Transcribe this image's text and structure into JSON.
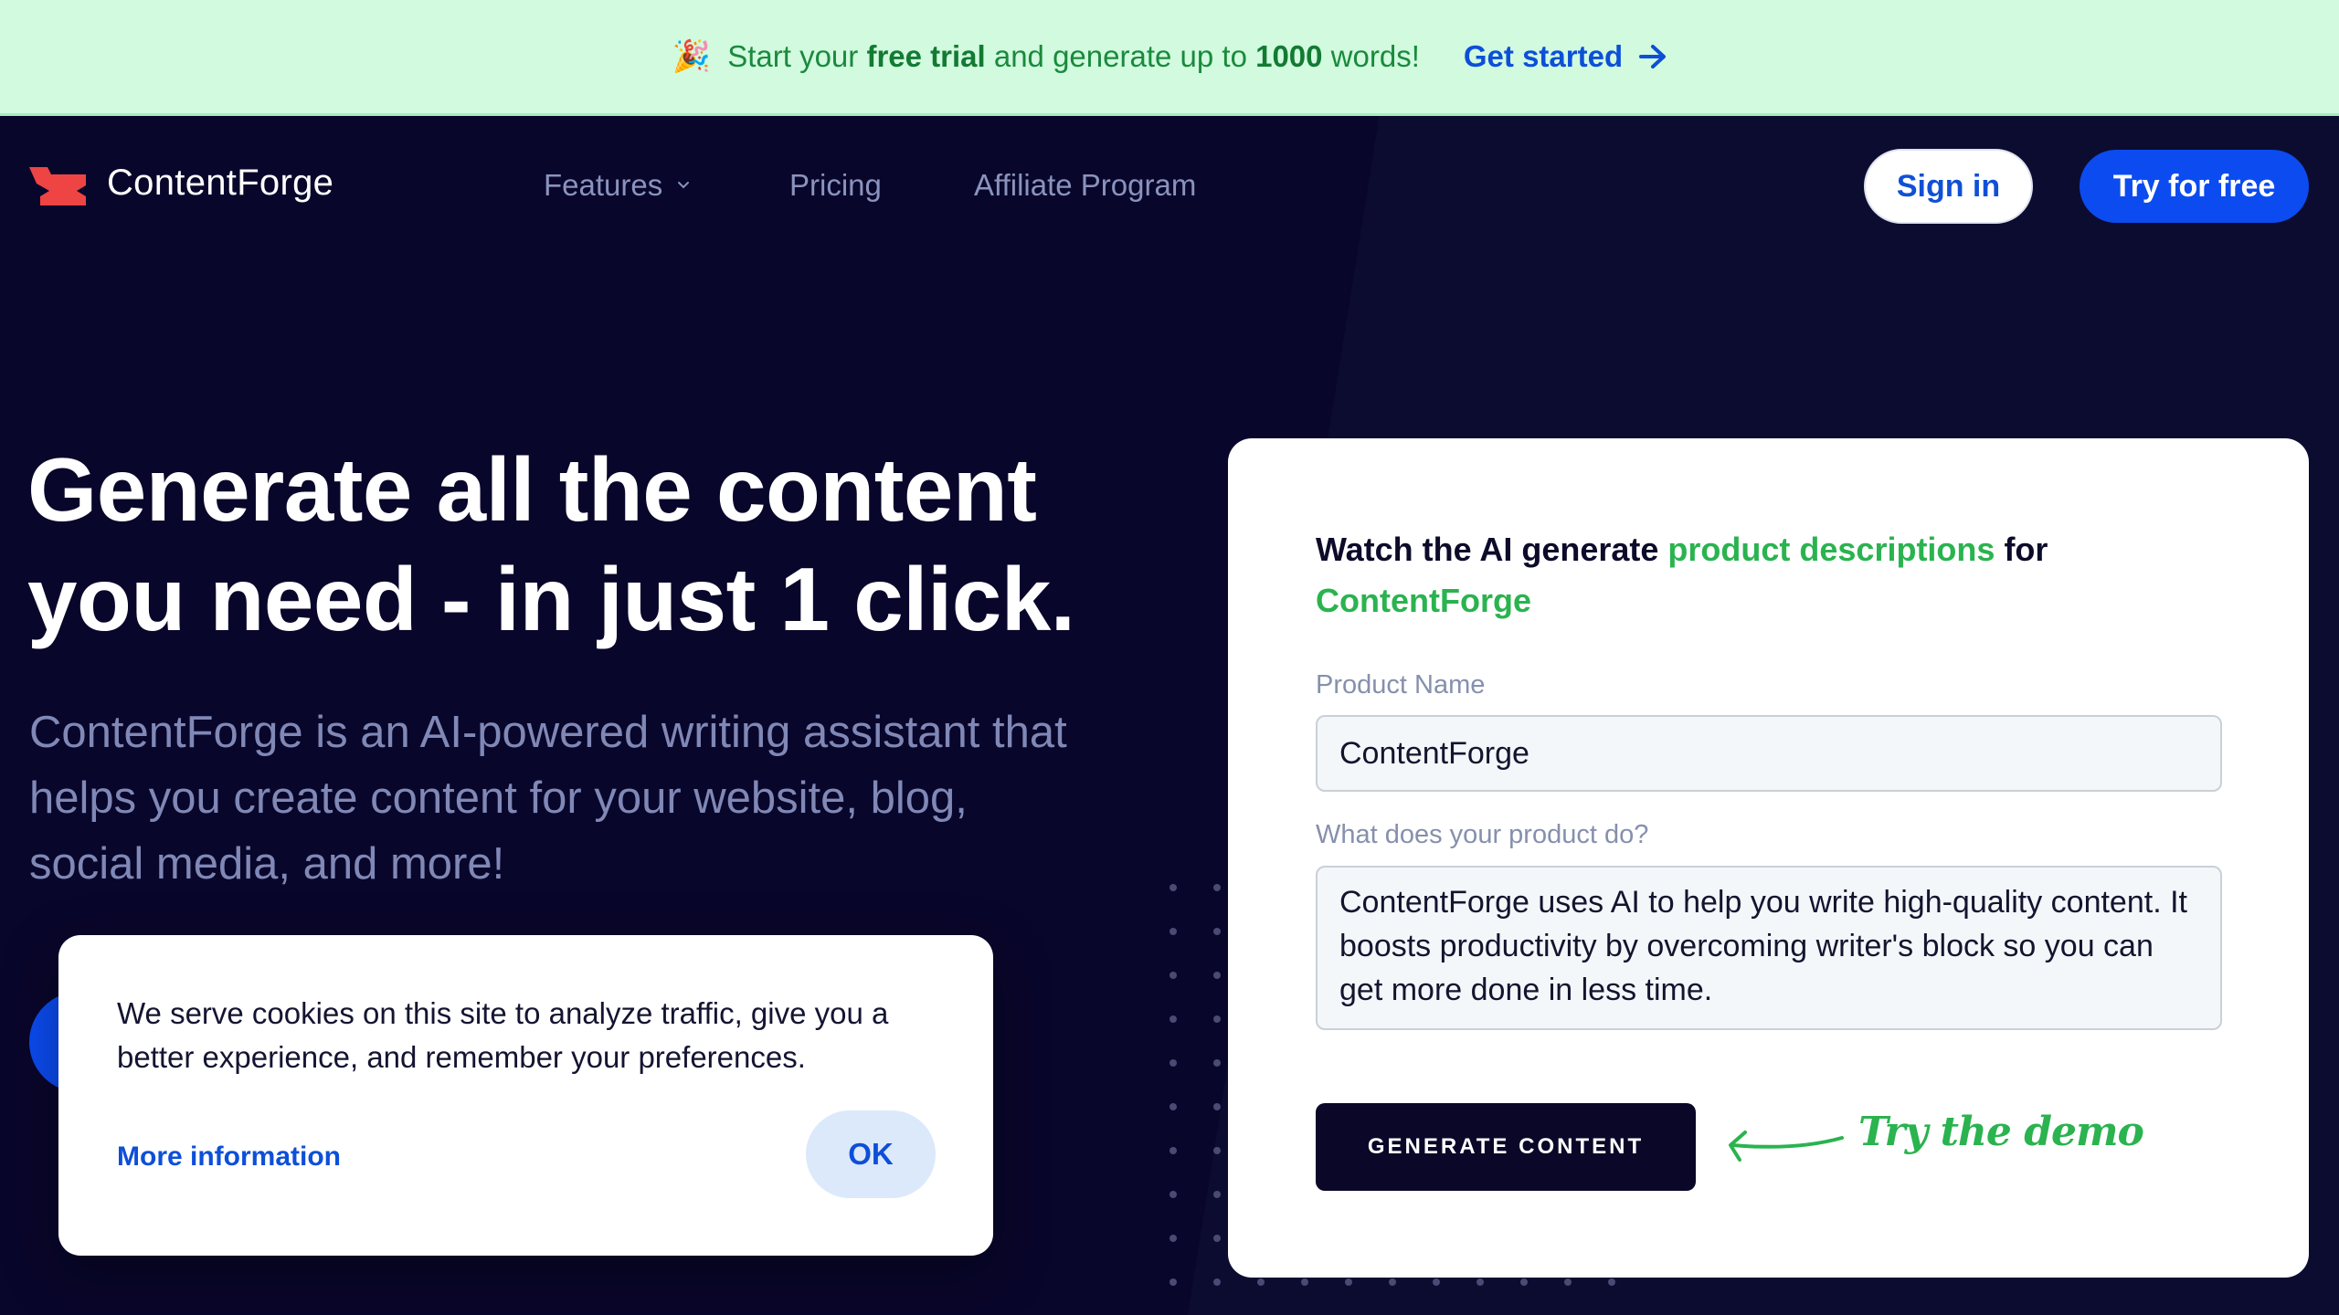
{
  "banner": {
    "emoji": "🎉",
    "text_before": "Start your ",
    "bold1": "free trial",
    "text_middle": " and generate up to ",
    "bold2": "1000",
    "text_after": " words!",
    "cta_label": "Get started",
    "cta_icon": "arrow-right-icon"
  },
  "nav": {
    "brand": "ContentForge",
    "items": [
      {
        "label": "Features",
        "has_dropdown": true
      },
      {
        "label": "Pricing"
      },
      {
        "label": "Affiliate Program"
      }
    ],
    "sign_in": "Sign in",
    "try_free": "Try for free"
  },
  "hero": {
    "title_line1": "Generate all the content",
    "title_line2": "you need - in just 1 click.",
    "subtitle": "ContentForge is an AI-powered writing assistant that helps you create content for your website, blog, social media, and more!"
  },
  "cookie": {
    "message": "We serve cookies on this site to analyze traffic, give you a better experience, and remember your preferences.",
    "more_info": "More information",
    "ok": "OK"
  },
  "demo": {
    "title_prefix": "Watch the AI generate ",
    "title_highlight": "product descriptions",
    "title_mid": " for ",
    "title_product": "ContentForge",
    "product_name_label": "Product Name",
    "product_name_value": "ContentForge",
    "description_label": "What does your product do?",
    "description_value": "ContentForge uses AI to help you write high-quality content. It boosts productivity by overcoming writer's block so you can get more done in less time.",
    "generate_button": "GENERATE CONTENT",
    "hint": "Try the demo"
  },
  "colors": {
    "background": "#09062b",
    "banner_bg": "#d1fadf",
    "accent_blue": "#0b4bf0",
    "accent_green": "#2ab34f",
    "logo_red": "#ef4444"
  }
}
